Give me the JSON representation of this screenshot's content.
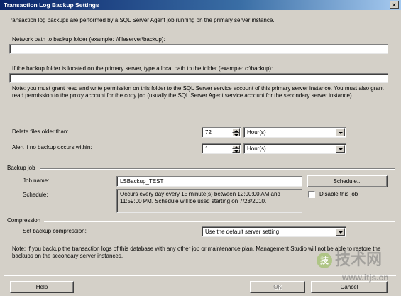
{
  "window": {
    "title": "Transaction Log Backup Settings",
    "close_glyph": "×"
  },
  "intro": "Transaction log backups are performed by a SQL Server Agent job running on the primary server instance.",
  "network_path": {
    "label": "Network path to backup folder (example: \\\\fileserver\\backup):",
    "value": ""
  },
  "local_path": {
    "label": "If the backup folder is located on the primary server, type a local path to the folder (example: c:\\backup):",
    "value": ""
  },
  "note": "Note: you must grant read and write permission on this folder to the SQL Server service account of this primary server instance.  You must also grant read permission to the proxy account for the copy job (usually the SQL Server Agent service account for the secondary server instance).",
  "delete_files": {
    "label": "Delete files older than:",
    "value": "72",
    "unit": "Hour(s)"
  },
  "alert": {
    "label": "Alert if no backup occurs within:",
    "value": "1",
    "unit": "Hour(s)"
  },
  "backup_job": {
    "section": "Backup job",
    "job_name_label": "Job name:",
    "job_name_value": "LSBackup_TEST",
    "schedule_button": "Schedule...",
    "schedule_label": "Schedule:",
    "schedule_text": "Occurs every day every 15 minute(s) between 12:00:00 AM and 11:59:00 PM. Schedule will be used starting on 7/23/2010.",
    "disable_label": "Disable this job",
    "disable_checked": false
  },
  "compression": {
    "section": "Compression",
    "label": "Set backup compression:",
    "value": "Use the default server setting"
  },
  "footer_note": "Note: If you backup the transaction logs of this database with any other job or maintenance plan, Management Studio will not be able to restore the backups on the secondary server instances.",
  "buttons": {
    "help": "Help",
    "ok": "OK",
    "cancel": "Cancel"
  },
  "watermark": {
    "logo": "技",
    "brand": "技术网",
    "url": "www.itjs.cn"
  }
}
